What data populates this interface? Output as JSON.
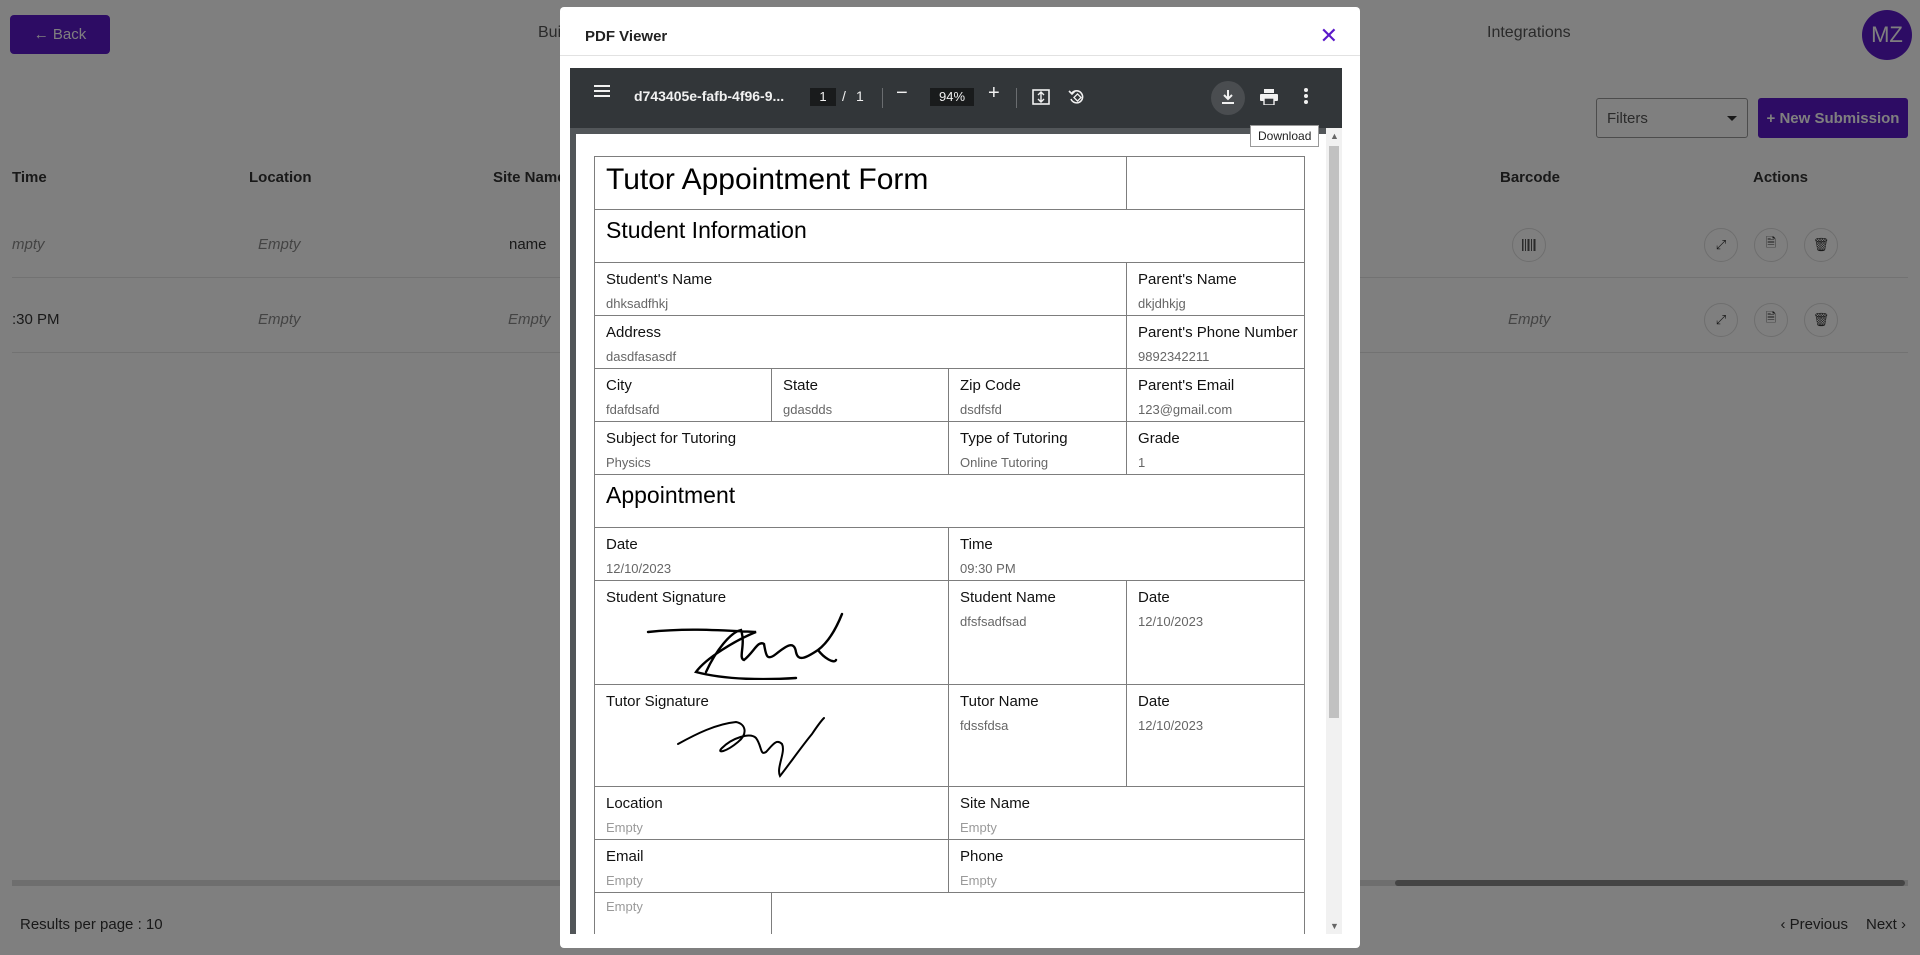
{
  "background": {
    "back_label": "← Back",
    "tabs": [
      "Bui",
      "Integrations"
    ],
    "avatar_initials": "MZ",
    "filters_label": "Filters",
    "new_submission_label": "+ New Submission",
    "columns": [
      "Time",
      "Location",
      "Site Name",
      "Barcode",
      "Actions"
    ],
    "rows": [
      {
        "time": "mpty",
        "location": "Empty",
        "site_name": "name",
        "barcode": ""
      },
      {
        "time": ":30 PM",
        "location": "Empty",
        "site_name": "Empty",
        "barcode": "Empty"
      }
    ],
    "results_per_page": "Results per page : 10",
    "prev_label": "‹ Previous",
    "next_label": "Next ›"
  },
  "modal": {
    "title": "PDF Viewer",
    "close_icon": "close-icon"
  },
  "viewer": {
    "file_name": "d743405e-fafb-4f96-9...",
    "page_current": "1",
    "page_sep": "/",
    "page_total": "1",
    "zoom": "94%",
    "tooltip": "Download"
  },
  "form": {
    "title": "Tutor Appointment Form",
    "student_section": "Student Information",
    "students_name_label": "Student's Name",
    "students_name": "dhksadfhkj",
    "parents_name_label": "Parent's Name",
    "parents_name": "dkjdhkjg",
    "address_label": "Address",
    "address": "dasdfasasdf",
    "parents_phone_label": "Parent's Phone Number",
    "parents_phone": "9892342211",
    "city_label": "City",
    "city": "fdafdsafd",
    "state_label": "State",
    "state": "gdasdds",
    "zip_label": "Zip Code",
    "zip": "dsdfsfd",
    "parents_email_label": "Parent's Email",
    "parents_email": "123@gmail.com",
    "subject_label": "Subject for Tutoring",
    "subject": "Physics",
    "tutoring_type_label": "Type of Tutoring",
    "tutoring_type": "Online Tutoring",
    "grade_label": "Grade",
    "grade": "1",
    "appointment_section": "Appointment",
    "date_label": "Date",
    "date": "12/10/2023",
    "time_label": "Time",
    "time": "09:30 PM",
    "student_signature_label": "Student Signature",
    "student_name_label": "Student Name",
    "student_name": "dfsfsadfsad",
    "student_sig_date_label": "Date",
    "student_sig_date": "12/10/2023",
    "tutor_signature_label": "Tutor Signature",
    "tutor_name_label": "Tutor Name",
    "tutor_name": "fdssfdsa",
    "tutor_sig_date_label": "Date",
    "tutor_sig_date": "12/10/2023",
    "location_label": "Location",
    "location": "Empty",
    "site_name_label": "Site Name",
    "site_name": "Empty",
    "email_label": "Email",
    "email": "Empty",
    "phone_label": "Phone",
    "phone": "Empty",
    "last_value": "Empty"
  }
}
